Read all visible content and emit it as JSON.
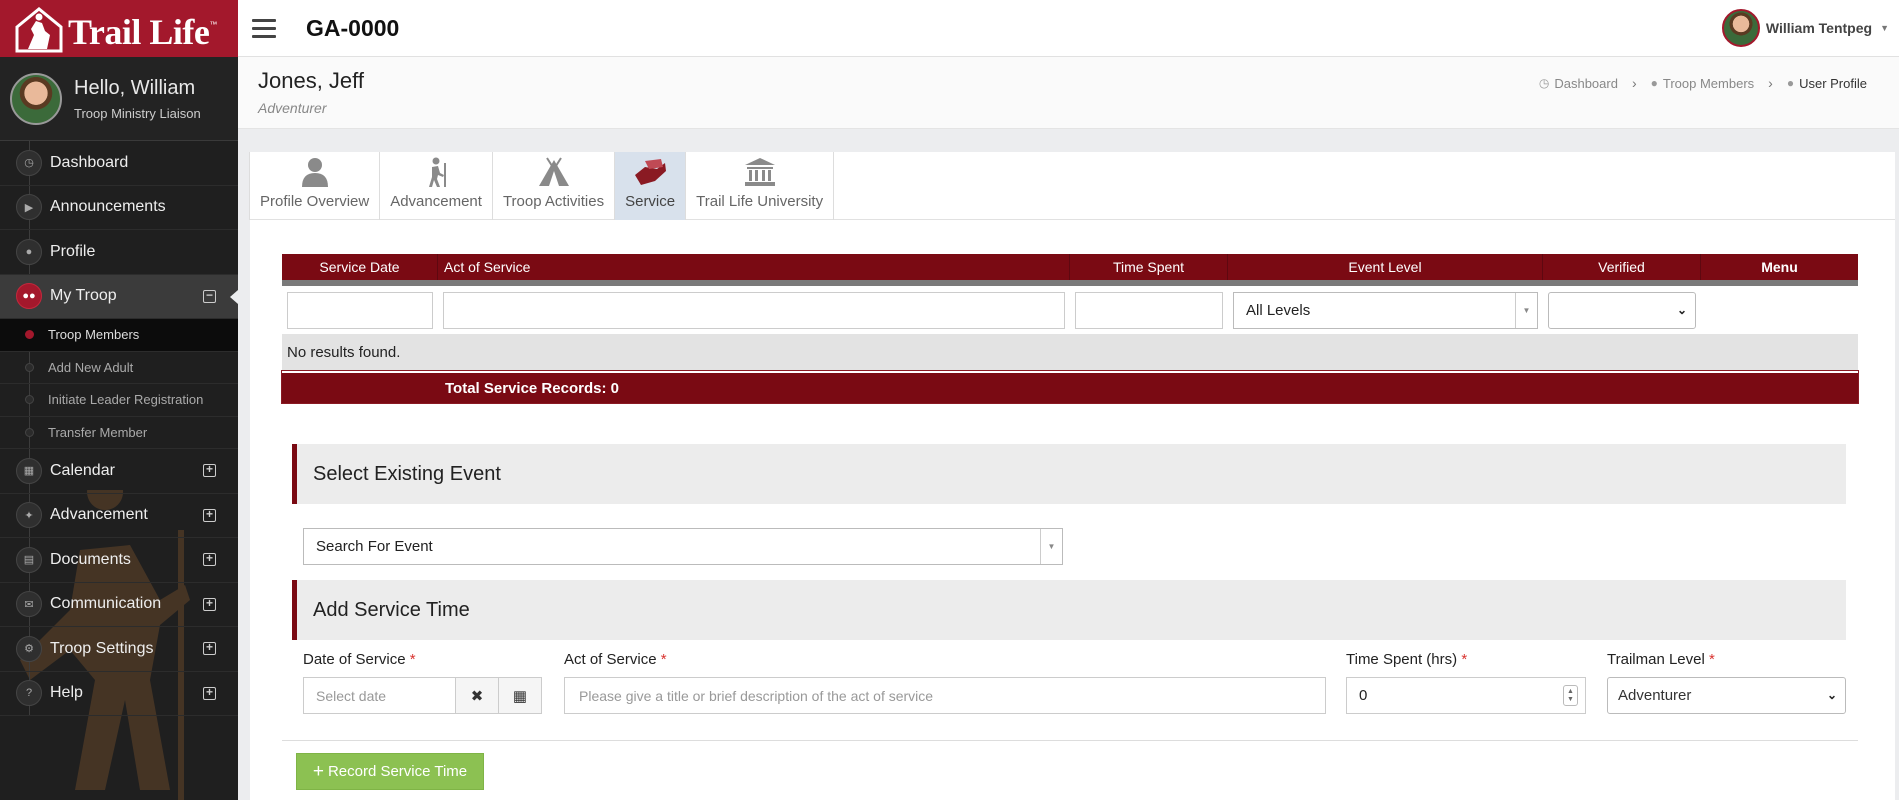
{
  "brand": {
    "logo_text": "Trail Life",
    "tm": "™"
  },
  "user_panel": {
    "greeting": "Hello, William",
    "role": "Troop Ministry Liaison"
  },
  "sidebar": {
    "items": [
      {
        "label": "Dashboard",
        "icon": "dashboard-icon"
      },
      {
        "label": "Announcements",
        "icon": "megaphone-icon"
      },
      {
        "label": "Profile",
        "icon": "user-icon"
      },
      {
        "label": "My Troop",
        "icon": "group-icon",
        "toggle": "−"
      },
      {
        "label": "Calendar",
        "icon": "calendar-icon",
        "toggle": "+"
      },
      {
        "label": "Advancement",
        "icon": "hiker-icon",
        "toggle": "+"
      },
      {
        "label": "Documents",
        "icon": "documents-icon",
        "toggle": "+"
      },
      {
        "label": "Communication",
        "icon": "envelope-icon",
        "toggle": "+"
      },
      {
        "label": "Troop Settings",
        "icon": "gears-icon",
        "toggle": "+"
      },
      {
        "label": "Help",
        "icon": "question-icon",
        "toggle": "+"
      }
    ],
    "subitems": [
      {
        "label": "Troop Members"
      },
      {
        "label": "Add New Adult"
      },
      {
        "label": "Initiate Leader Registration"
      },
      {
        "label": "Transfer Member"
      }
    ]
  },
  "topbar": {
    "troop_code": "GA-0000",
    "user_name": "William Tentpeg"
  },
  "header": {
    "name": "Jones, Jeff",
    "rank": "Adventurer",
    "breadcrumb": [
      "Dashboard",
      "Troop Members",
      "User Profile"
    ]
  },
  "tabs": [
    {
      "label": "Profile Overview",
      "icon": "person-icon"
    },
    {
      "label": "Advancement",
      "icon": "hiker-icon"
    },
    {
      "label": "Troop Activities",
      "icon": "tent-icon"
    },
    {
      "label": "Service",
      "icon": "service-hand-icon"
    },
    {
      "label": "Trail Life University",
      "icon": "university-icon"
    }
  ],
  "table": {
    "columns": [
      "Service Date",
      "Act of Service",
      "Time Spent",
      "Event Level",
      "Verified",
      "Menu"
    ],
    "event_level_filter": "All Levels",
    "verified_filter": "",
    "no_results": "No results found.",
    "total": "Total Service Records: 0"
  },
  "select_event": {
    "heading": "Select Existing Event",
    "placeholder": "Search For Event"
  },
  "add_service": {
    "heading": "Add Service Time",
    "date_label": "Date of Service",
    "date_placeholder": "Select date",
    "act_label": "Act of Service",
    "act_placeholder": "Please give a title or brief description of the act of service",
    "time_label": "Time Spent (hrs)",
    "time_value": "0",
    "level_label": "Trailman Level",
    "level_value": "Adventurer",
    "required_mark": "*",
    "submit_label": "Record Service Time",
    "submit_icon": "+"
  },
  "colors": {
    "brand_red": "#a3182c",
    "table_red": "#7a0a13",
    "success_green": "#8cc152"
  }
}
